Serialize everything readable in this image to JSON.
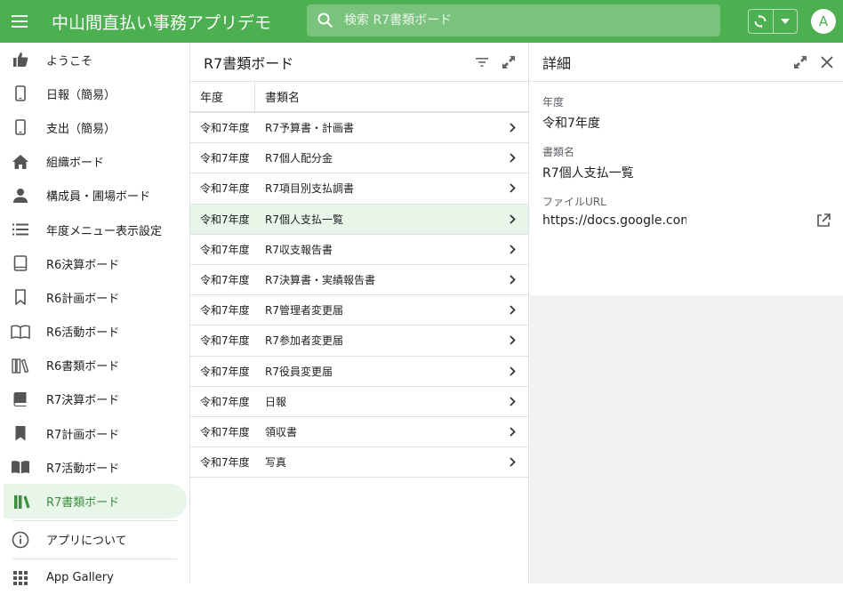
{
  "header": {
    "title": "中山間直払い事務アプリデモ",
    "search_placeholder": "検索 R7書類ボード",
    "avatar_letter": "A",
    "brand_color": "#4caf50"
  },
  "sidebar": {
    "items": [
      {
        "label": "ようこそ",
        "icon": "thumb-up-icon"
      },
      {
        "label": "日報（簡易）",
        "icon": "phone-icon"
      },
      {
        "label": "支出（簡易）",
        "icon": "phone-icon"
      },
      {
        "label": "組織ボード",
        "icon": "home-icon"
      },
      {
        "label": "構成員・圃場ボード",
        "icon": "person-icon"
      },
      {
        "label": "年度メニュー表示設定",
        "icon": "list-icon"
      },
      {
        "label": "R6決算ボード",
        "icon": "book-outline-icon"
      },
      {
        "label": "R6計画ボード",
        "icon": "bookmark-outline-icon"
      },
      {
        "label": "R6活動ボード",
        "icon": "open-book-outline-icon"
      },
      {
        "label": "R6書類ボード",
        "icon": "library-outline-icon"
      },
      {
        "label": "R7決算ボード",
        "icon": "book-icon"
      },
      {
        "label": "R7計画ボード",
        "icon": "bookmark-icon"
      },
      {
        "label": "R7活動ボード",
        "icon": "open-book-icon"
      },
      {
        "label": "R7書類ボード",
        "icon": "library-icon",
        "active": true
      }
    ],
    "about_label": "アプリについて",
    "gallery_label": "App Gallery"
  },
  "list": {
    "title": "R7書類ボード",
    "col_year": "年度",
    "col_name": "書類名",
    "rows": [
      {
        "year": "令和7年度",
        "name": "R7予算書・計画書"
      },
      {
        "year": "令和7年度",
        "name": "R7個人配分金"
      },
      {
        "year": "令和7年度",
        "name": "R7項目別支払調書"
      },
      {
        "year": "令和7年度",
        "name": "R7個人支払一覧",
        "selected": true
      },
      {
        "year": "令和7年度",
        "name": "R7収支報告書"
      },
      {
        "year": "令和7年度",
        "name": "R7決算書・実績報告書"
      },
      {
        "year": "令和7年度",
        "name": "R7管理者変更届"
      },
      {
        "year": "令和7年度",
        "name": "R7参加者変更届"
      },
      {
        "year": "令和7年度",
        "name": "R7役員変更届"
      },
      {
        "year": "令和7年度",
        "name": "日報"
      },
      {
        "year": "令和7年度",
        "name": "領収書"
      },
      {
        "year": "令和7年度",
        "name": "写真"
      }
    ]
  },
  "detail": {
    "title": "詳細",
    "year_label": "年度",
    "year_value": "令和7年度",
    "name_label": "書類名",
    "name_value": "R7個人支払一覧",
    "url_label": "ファイルURL",
    "url_value": "https://docs.google.com/spreadsheets/..."
  }
}
